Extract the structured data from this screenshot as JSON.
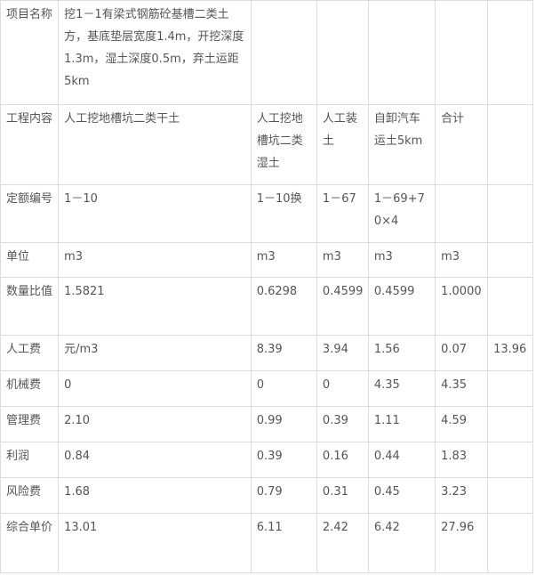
{
  "table": {
    "rows": [
      [
        "项目名称",
        "挖1－1有梁式钢筋砼基槽二类土方，基底垫层宽度1.4m，开挖深度1.3m，湿土深度0.5m，弃土运距5km",
        "",
        "",
        "",
        "",
        ""
      ],
      [
        "工程内容",
        "人工挖地槽坑二类干土",
        "人工挖地槽坑二类湿土",
        "人工装土",
        "自卸汽车运土5km",
        "合计",
        ""
      ],
      [
        "定额编号",
        "1－10",
        "1－10换",
        "1－67",
        "1－69+70×4",
        "",
        ""
      ],
      [
        "单位",
        "m3",
        "m3",
        "m3",
        "m3",
        "m3",
        ""
      ],
      [
        "数量比值",
        "1.5821",
        "0.6298",
        "0.4599",
        "0.4599",
        "1.0000",
        ""
      ],
      [
        "人工费",
        "元/m3",
        "8.39",
        "3.94",
        "1.56",
        "0.07",
        "13.96"
      ],
      [
        "机械费",
        "0",
        "0",
        "0",
        "4.35",
        "4.35",
        ""
      ],
      [
        "管理费",
        "2.10",
        "0.99",
        "0.39",
        "1.11",
        "4.59",
        ""
      ],
      [
        "利润",
        "0.84",
        "0.39",
        "0.16",
        "0.44",
        "1.83",
        ""
      ],
      [
        "风险费",
        "1.68",
        "0.79",
        "0.31",
        "0.45",
        "3.23",
        ""
      ],
      [
        "综合单价",
        "13.01",
        "6.11",
        "2.42",
        "6.42",
        "27.96",
        ""
      ]
    ]
  }
}
